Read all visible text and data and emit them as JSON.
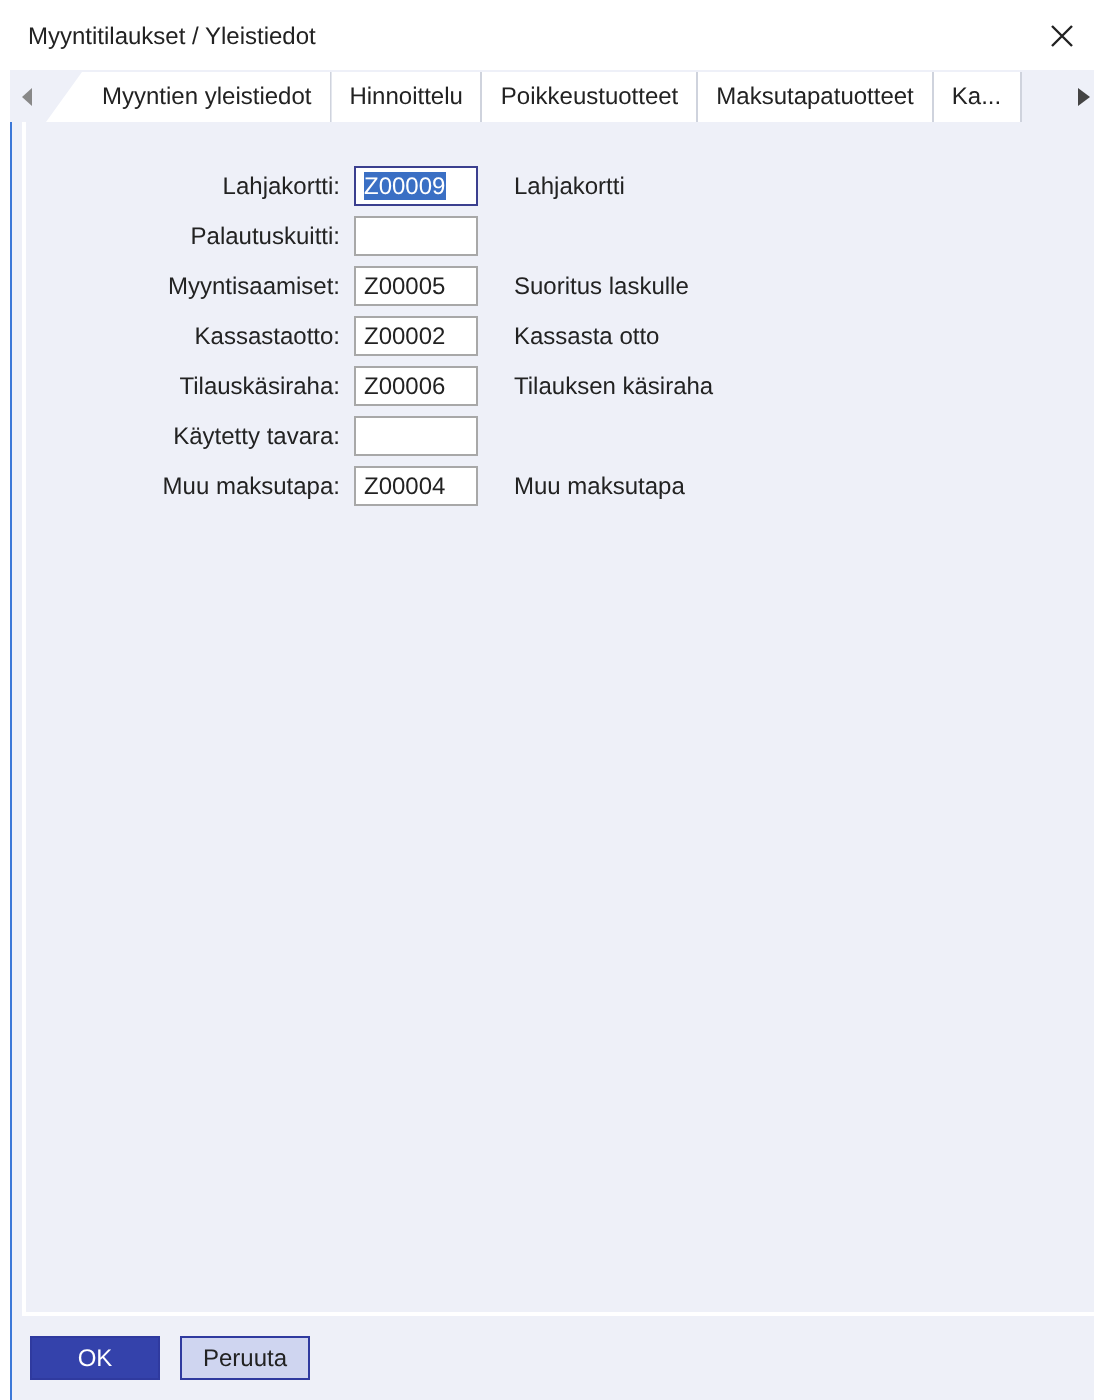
{
  "window": {
    "title": "Myyntitilaukset / Yleistiedot"
  },
  "tabs": [
    {
      "label": "Myyntien yleistiedot",
      "selected": true
    },
    {
      "label": "Hinnoittelu",
      "selected": false
    },
    {
      "label": "Poikkeustuotteet",
      "selected": false
    },
    {
      "label": "Maksutapatuotteet",
      "selected": false
    },
    {
      "label": "Ka...",
      "selected": false
    }
  ],
  "fields": [
    {
      "label": "Lahjakortti:",
      "value": "Z00009",
      "description": "Lahjakortti",
      "selected": true
    },
    {
      "label": "Palautuskuitti:",
      "selected": false
    },
    {
      "label": "Myyntisaamiset:",
      "value": "Z00005",
      "description": "Suoritus laskulle",
      "selected": false
    },
    {
      "label": "Kassastaotto:",
      "value": "Z00002",
      "description": "Kassasta otto",
      "selected": false
    },
    {
      "label": "Tilauskäsiraha:",
      "value": "Z00006",
      "description": "Tilauksen käsiraha",
      "selected": false
    },
    {
      "label": "Käytetty tavara:",
      "selected": false
    },
    {
      "label": "Muu maksutapa:",
      "value": "Z00004",
      "description": "Muu maksutapa",
      "selected": false
    }
  ],
  "buttons": [
    {
      "label": "OK",
      "kind": "primary"
    },
    {
      "label": "Peruuta",
      "kind": "secondary"
    }
  ]
}
